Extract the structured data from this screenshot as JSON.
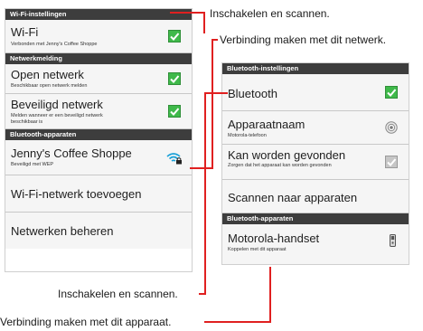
{
  "wifi_screen": {
    "header1": "Wi-Fi-instellingen",
    "wifi": {
      "title": "Wi-Fi",
      "subtitle": "Verbonden met Jenny's Coffee Shoppe",
      "checked": true
    },
    "header2": "Netwerkmelding",
    "open_network": {
      "title": "Open netwerk",
      "subtitle": "Beschikbaar open netwerk melden",
      "checked": true
    },
    "secure_network": {
      "title": "Beveiligd netwerk",
      "subtitle": "Melden wanneer er een beveiligd netwerk beschikbaar is",
      "checked": true
    },
    "header3": "Bluetooth-apparaten",
    "network_item": {
      "title": "Jenny's Coffee Shoppe",
      "subtitle": "Beveiligd met WEP",
      "icon": "wifi-lock-icon"
    },
    "add_network": "Wi-Fi-netwerk toevoegen",
    "manage_networks": "Netwerken beheren"
  },
  "bt_screen": {
    "header1": "Bluetooth-instellingen",
    "bluetooth": {
      "title": "Bluetooth",
      "checked": true
    },
    "device_name": {
      "title": "Apparaatnaam",
      "subtitle": "Motorola-telefoon",
      "icon": "eye-icon"
    },
    "discoverable": {
      "title": "Kan worden gevonden",
      "subtitle": "Zorgen dat het apparaat kan worden gevonden",
      "checked": true,
      "disabled": true
    },
    "scan": "Scannen naar apparaten",
    "header2": "Bluetooth-apparaten",
    "device": {
      "title": "Motorola-handset",
      "subtitle": "Koppelen met dit apparaat",
      "icon": "phone-icon"
    }
  },
  "callouts": {
    "top1": "Inschakelen en scannen.",
    "top2": "Verbinding maken met dit netwerk.",
    "bottom1": "Inschakelen en scannen.",
    "bottom2": "Verbinding maken met dit apparaat."
  },
  "colors": {
    "check_green": "#3fb94a",
    "header_bg": "#3d3d3d",
    "callout_line": "#e02020"
  }
}
